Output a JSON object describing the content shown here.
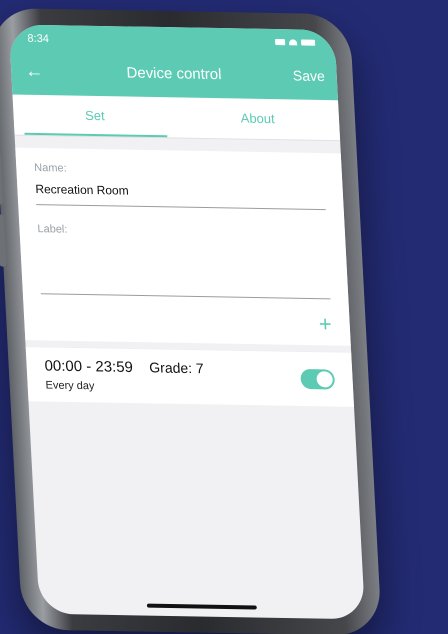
{
  "status": {
    "time": "8:34"
  },
  "header": {
    "title": "Device control",
    "save_label": "Save",
    "back_icon": "arrow-left-icon"
  },
  "tabs": [
    {
      "label": "Set",
      "active": true
    },
    {
      "label": "About",
      "active": false
    }
  ],
  "form": {
    "name_label": "Name:",
    "name_value": "Recreation Room",
    "label_label": "Label:",
    "label_value": ""
  },
  "schedule": [
    {
      "time": "00:00 - 23:59",
      "grade": "Grade: 7",
      "repeat": "Every day",
      "enabled": true
    }
  ],
  "colors": {
    "accent": "#5dcbb4",
    "background": "#232b73"
  }
}
